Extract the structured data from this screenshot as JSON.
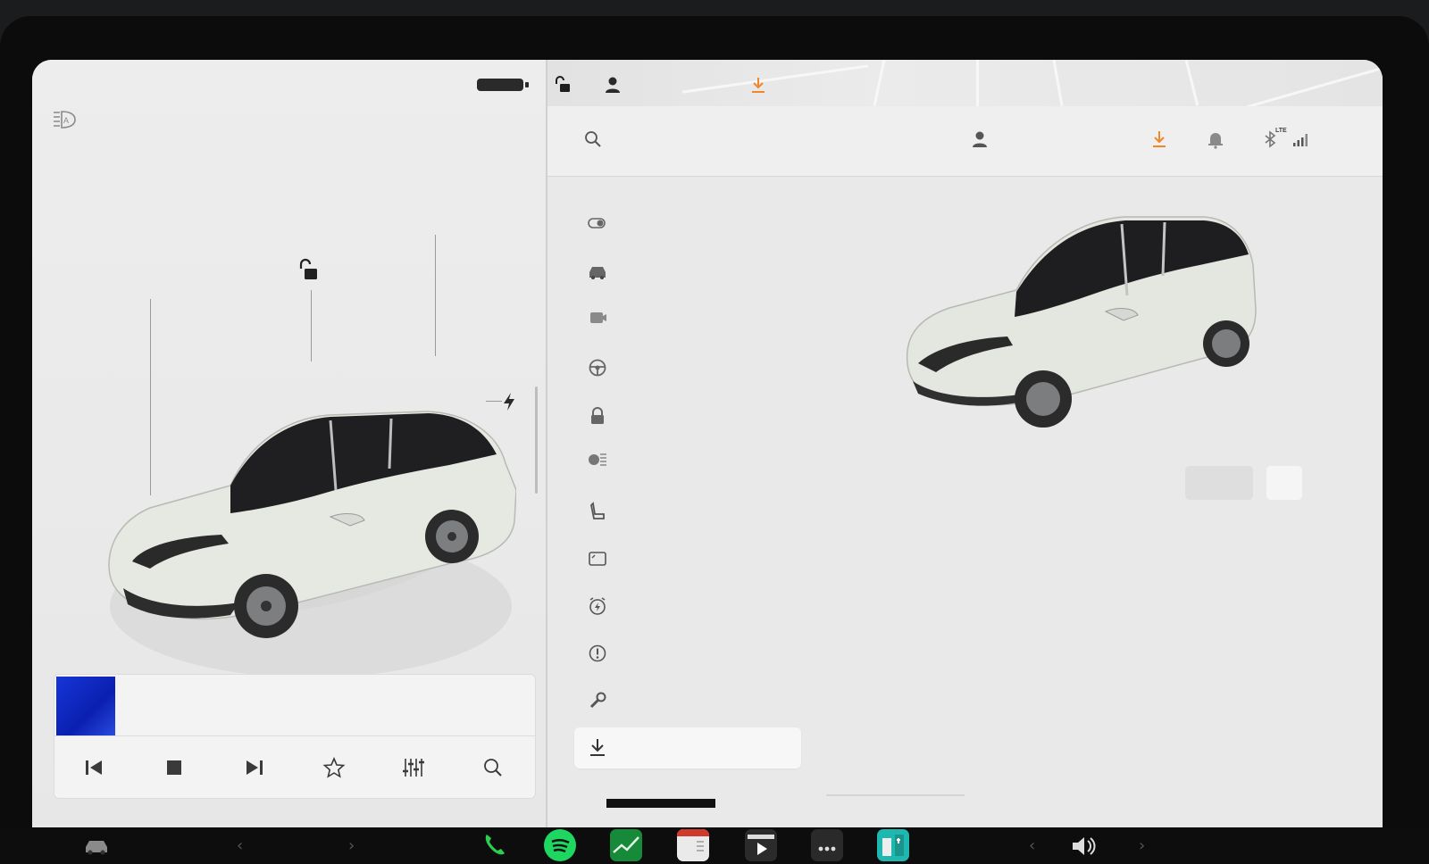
{
  "status_bar": {
    "icons": [
      "battery-icon",
      "unlocked-icon",
      "profile-icon",
      "download-icon"
    ]
  },
  "left_pane": {
    "icons": [
      "auto-headlights-icon",
      "unlocked-icon",
      "charge-port-icon"
    ],
    "media": {
      "album_art_color": "#1636d8",
      "controls": [
        "previous-track-icon",
        "stop-icon",
        "next-track-icon",
        "favorite-star-icon",
        "equalizer-icon",
        "search-icon"
      ]
    }
  },
  "right_pane": {
    "header_icons": [
      "search-icon",
      "profile-icon",
      "download-icon",
      "notification-bell-icon",
      "bluetooth-icon",
      "signal-icon"
    ],
    "signal_label": "LTE",
    "nav_icons": [
      "controls-toggle-icon",
      "car-icon",
      "dashcam-icon",
      "steering-wheel-icon",
      "lock-icon",
      "lights-icon",
      "seat-icon",
      "display-icon",
      "schedule-charge-icon",
      "safety-alert-icon",
      "service-wrench-icon",
      "download-icon"
    ],
    "accent_color": "#f0882a"
  },
  "dock": {
    "apps": [
      "car-icon",
      "phone-icon",
      "spotify-icon",
      "stocks-icon",
      "calendar-icon",
      "theater-icon",
      "more-icon",
      "toybox-icon",
      "volume-icon"
    ]
  }
}
